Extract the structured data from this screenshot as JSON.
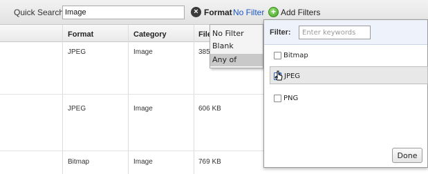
{
  "search": {
    "label": "Quick Search",
    "value": "Image",
    "filter_label": "Format",
    "filter_link": "No Filter",
    "add_filters": "Add Filters",
    "clear_icon": "x-circle-icon",
    "add_icon": "plus-circle-icon"
  },
  "table": {
    "columns": [
      "Format",
      "Category",
      "File"
    ],
    "rows": [
      {
        "format": "JPEG",
        "category": "Image",
        "size": "385"
      },
      {
        "format": "JPEG",
        "category": "Image",
        "size": "606 KB"
      },
      {
        "format": "Bitmap",
        "category": "Image",
        "size": "769 KB"
      }
    ]
  },
  "dropdown": {
    "items": [
      "No Filter",
      "Blank",
      "Any of"
    ],
    "selected": "Any of"
  },
  "filter_panel": {
    "label": "Filter:",
    "placeholder": "Enter keywords",
    "options": [
      {
        "label": "Bitmap",
        "checked": false
      },
      {
        "label": "JPEG",
        "checked": true
      },
      {
        "label": "PNG",
        "checked": false
      }
    ],
    "done": "Done"
  },
  "colors": {
    "link": "#1a56c4",
    "highlight": "#e8e8e8",
    "check": "#1f53c2"
  }
}
